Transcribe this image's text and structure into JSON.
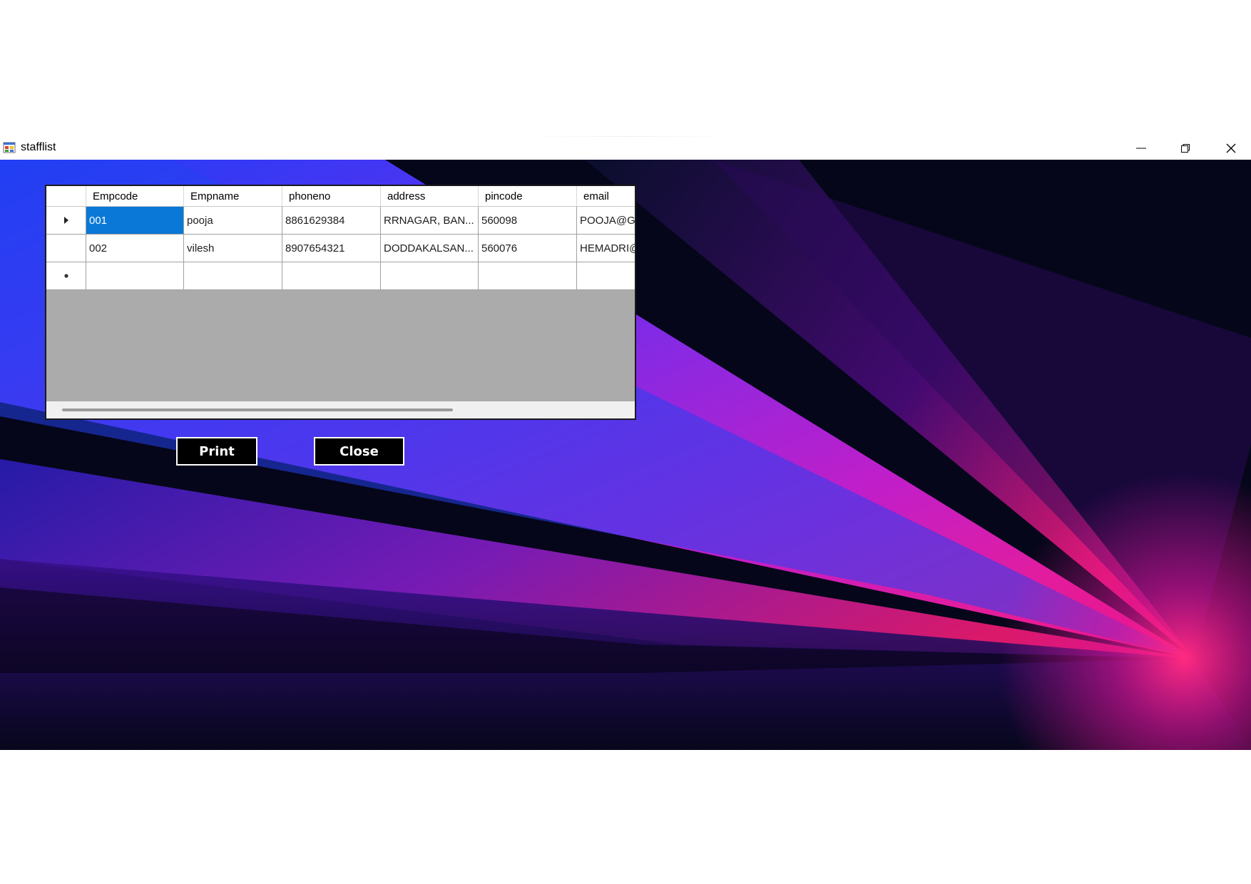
{
  "window": {
    "title": "stafflist",
    "controls": {
      "minimize": "minimize-icon",
      "maximize": "restore-icon",
      "close": "close-icon"
    }
  },
  "grid": {
    "columns": [
      "Empcode",
      "Empname",
      "phoneno",
      "address",
      "pincode",
      "email"
    ],
    "rows": [
      {
        "Empcode": "001",
        "Empname": "pooja",
        "phoneno": "8861629384",
        "address": "RRNAGAR, BAN...",
        "pincode": "560098",
        "email": "POOJA@GM"
      },
      {
        "Empcode": "002",
        "Empname": "vilesh",
        "phoneno": "8907654321",
        "address": "DODDAKALSAN...",
        "pincode": "560076",
        "email": "HEMADRI@"
      }
    ],
    "current_row_indicator": "▶",
    "new_row_indicator": "*",
    "selected_cell": "Empcode of row 1"
  },
  "buttons": {
    "print_label": "Print",
    "close_label": "Close"
  },
  "colors": {
    "selection": "#0a78d7",
    "grid_background": "#ababab",
    "button_background": "#000000",
    "accent_pink": "#ff1c78",
    "accent_blue": "#2b3ef0"
  }
}
